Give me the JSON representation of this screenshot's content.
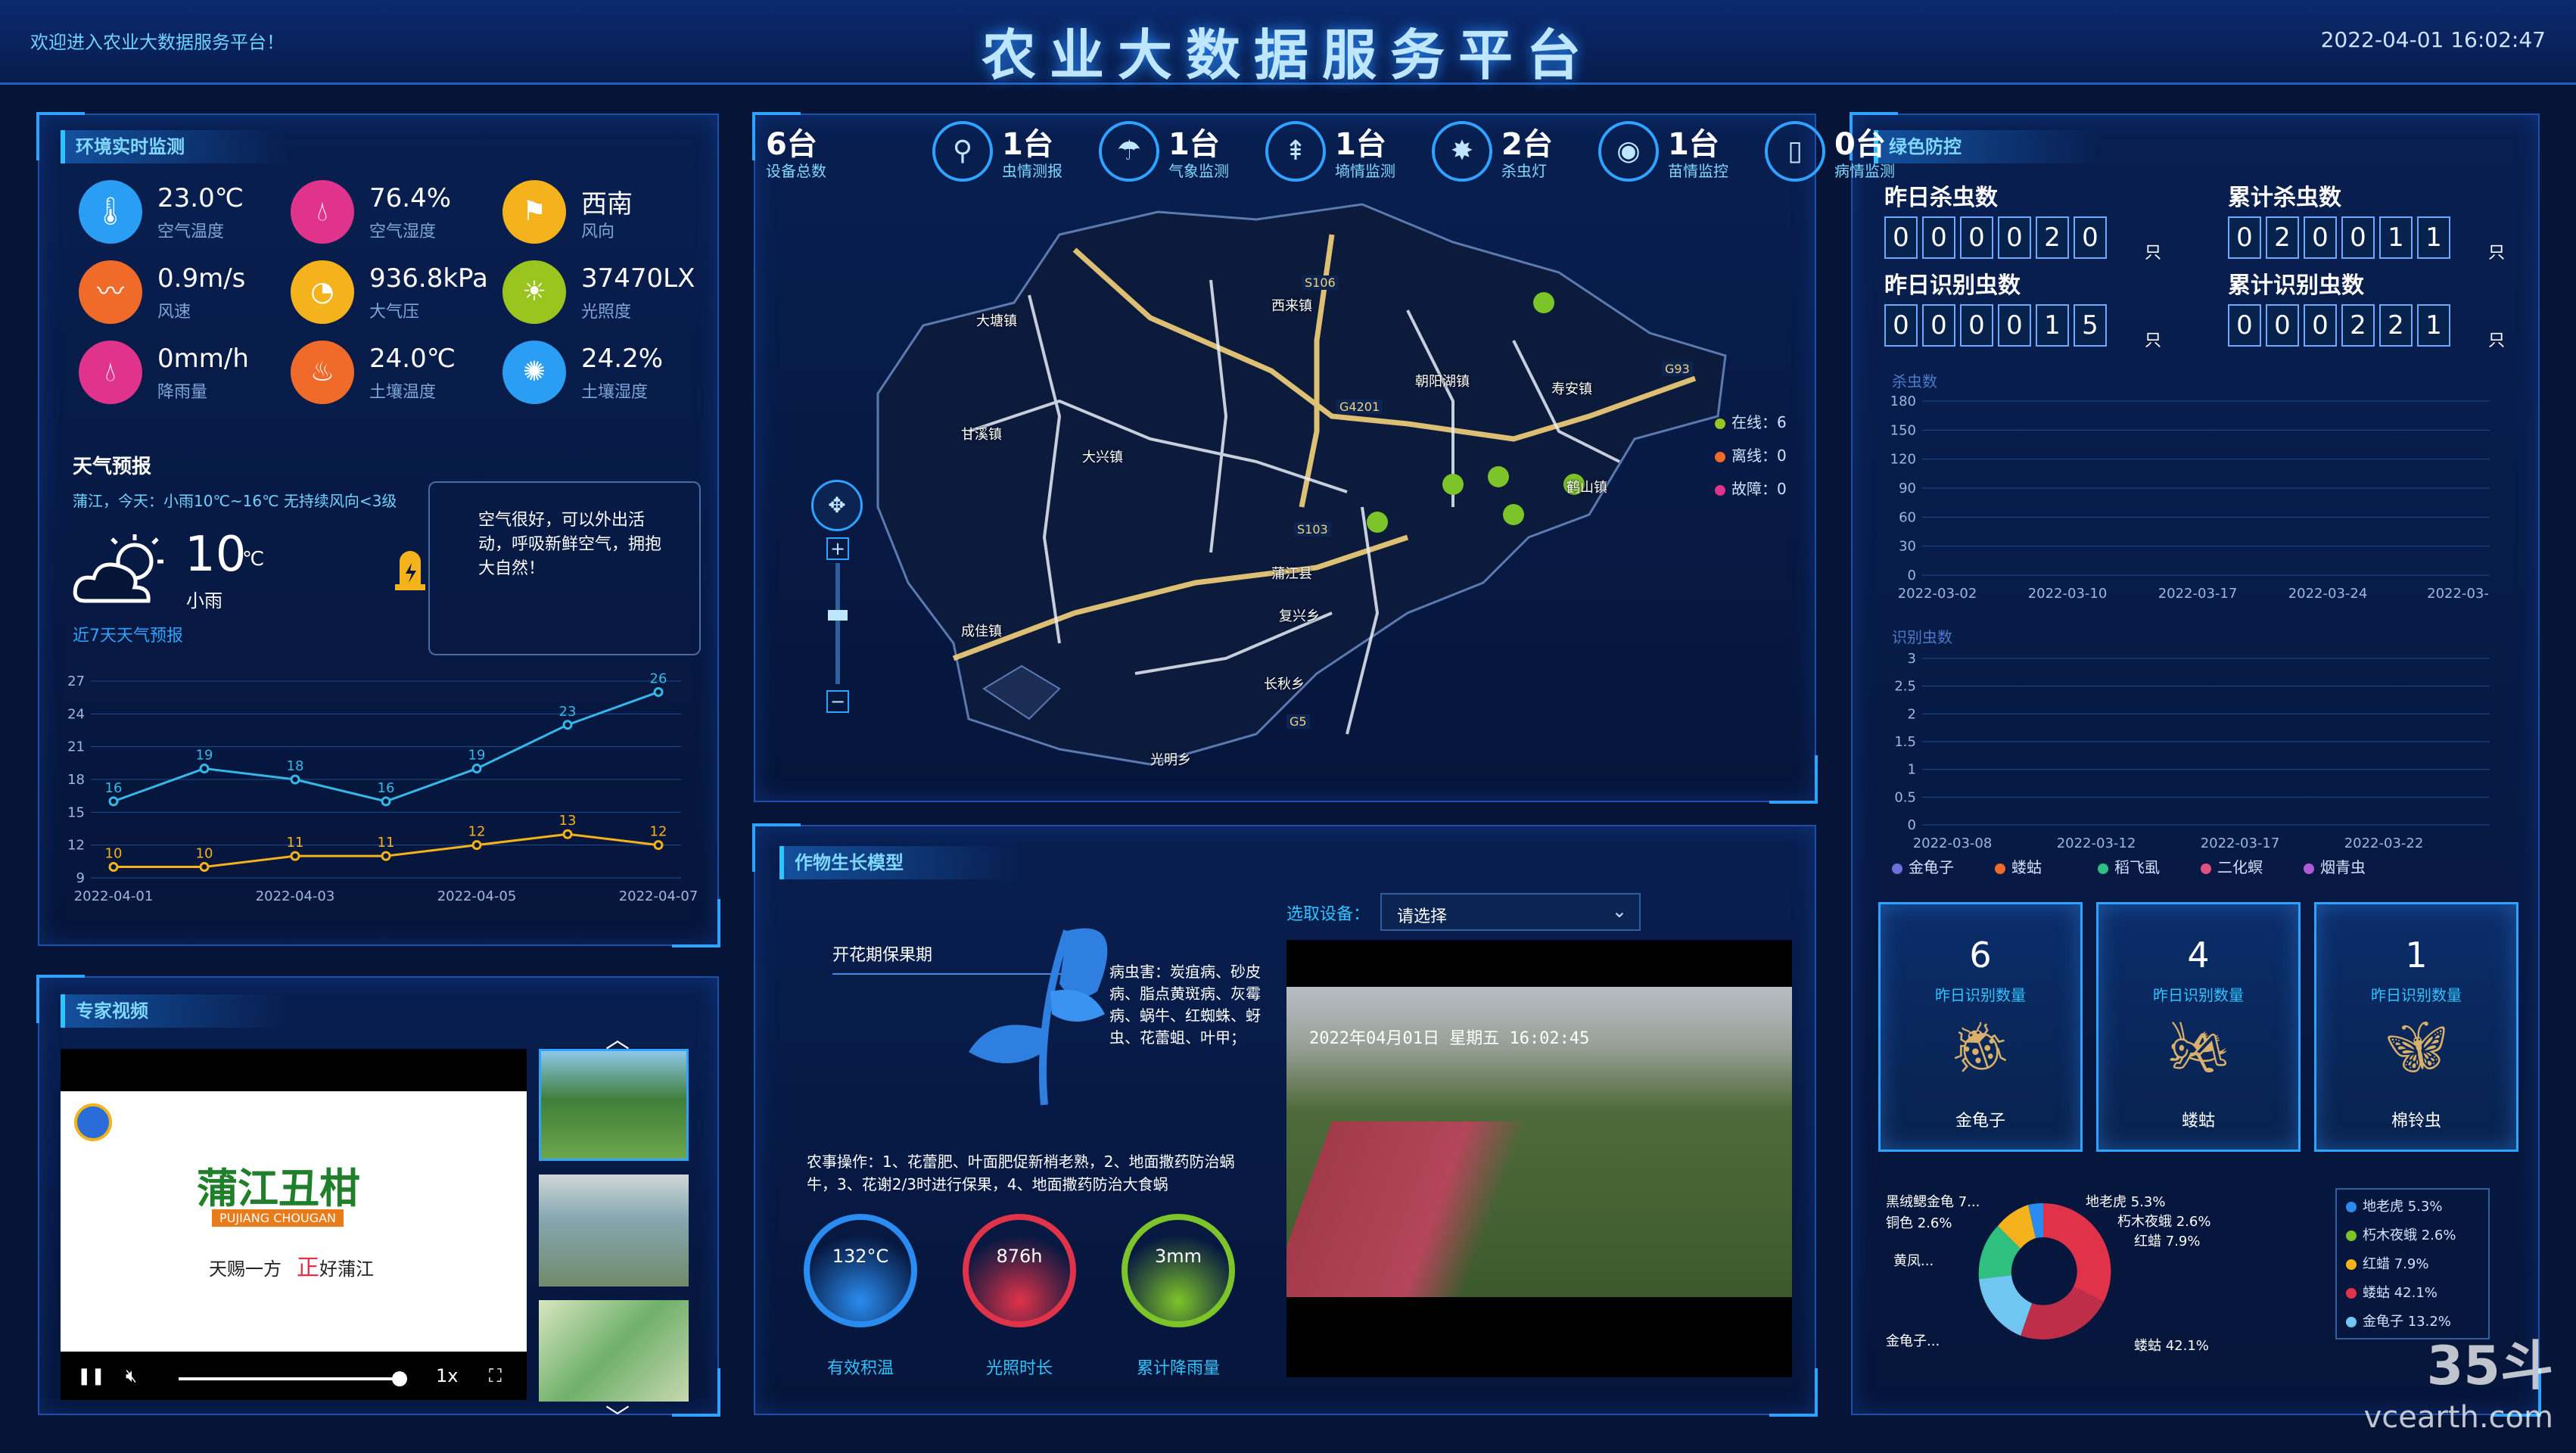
{
  "header": {
    "title": "农业大数据服务平台",
    "welcome": "欢迎进入农业大数据服务平台！",
    "datetime": "2022-04-01 16:02:47"
  },
  "env": {
    "title": "环境实时监测",
    "items": [
      {
        "value": "23.0℃",
        "label": "空气温度",
        "icon": "thermometer-icon",
        "color": "#2a9df4"
      },
      {
        "value": "76.4%",
        "label": "空气湿度",
        "icon": "humidity-icon",
        "color": "#e0338c"
      },
      {
        "value": "西南",
        "label": "风向",
        "icon": "wind-direction-icon",
        "color": "#f4b21c"
      },
      {
        "value": "0.9m/s",
        "label": "风速",
        "icon": "wind-speed-icon",
        "color": "#f06a2a"
      },
      {
        "value": "936.8kPa",
        "label": "大气压",
        "icon": "gauge-icon",
        "color": "#f4b21c"
      },
      {
        "value": "37470LX",
        "label": "光照度",
        "icon": "sun-icon",
        "color": "#9ac51f"
      },
      {
        "value": "0mm/h",
        "label": "降雨量",
        "icon": "rain-drop-icon",
        "color": "#e0338c"
      },
      {
        "value": "24.0℃",
        "label": "土壤温度",
        "icon": "soil-temp-icon",
        "color": "#f06a2a"
      },
      {
        "value": "24.2%",
        "label": "土壤湿度",
        "icon": "soil-humidity-icon",
        "color": "#2a9df4"
      }
    ]
  },
  "weather": {
    "title": "天气预报",
    "summary": "蒲江，今天：小雨10℃~16℃ 无持续风向<3级",
    "temp": "10",
    "temp_unit": "℃",
    "condition": "小雨",
    "link": "近7天天气预报",
    "alert": "空气很好，可以外出活动，呼吸新鲜空气，拥抱大自然！"
  },
  "weather_chart": {
    "type": "line",
    "x": [
      "2022-04-01",
      "2022-04-02",
      "2022-04-03",
      "2022-04-04",
      "2022-04-05",
      "2022-04-06",
      "2022-04-07"
    ],
    "x_tick_labels": [
      "2022-04-01",
      "2022-04-03",
      "2022-04-05",
      "2022-04-07"
    ],
    "y_ticks": [
      9,
      12,
      15,
      18,
      21,
      24,
      27
    ],
    "ylim": [
      9,
      27
    ],
    "series": [
      {
        "values": [
          16,
          19,
          18,
          16,
          19,
          23,
          26
        ],
        "color": "#35b8e8"
      },
      {
        "values": [
          10,
          10,
          11,
          11,
          12,
          13,
          12
        ],
        "color": "#f4b21c"
      }
    ]
  },
  "video": {
    "title": "专家视频",
    "brand_cn": "蒲江丑柑",
    "brand_en": "PUJIANG CHOUGAN",
    "slogan_a": "天赐一方",
    "slogan_b": "正",
    "slogan_c": "好蒲江",
    "speed": "1x"
  },
  "devices": [
    {
      "num": "6台",
      "label": "设备总数"
    },
    {
      "num": "1台",
      "label": "虫情测报",
      "icon": "pest-monitor-icon"
    },
    {
      "num": "1台",
      "label": "气象监测",
      "icon": "weather-station-icon"
    },
    {
      "num": "1台",
      "label": "墒情监测",
      "icon": "soil-sensor-icon"
    },
    {
      "num": "2台",
      "label": "杀虫灯",
      "icon": "insect-lamp-icon"
    },
    {
      "num": "1台",
      "label": "苗情监控",
      "icon": "camera-icon"
    },
    {
      "num": "0台",
      "label": "病情监测",
      "icon": "disease-monitor-icon"
    }
  ],
  "map": {
    "status": [
      {
        "label": "在线：6",
        "color": "#9ac51f"
      },
      {
        "label": "离线：0",
        "color": "#f06a2a"
      },
      {
        "label": "故障：0",
        "color": "#e0338c"
      }
    ],
    "towns": [
      "甘溪镇",
      "西来镇",
      "大塘镇",
      "朝阳湖镇",
      "成佳镇",
      "寿安镇",
      "鹤山镇",
      "复兴乡",
      "长秋乡",
      "大兴镇",
      "光明乡",
      "蒲江县"
    ],
    "roads": [
      "S106",
      "G4201",
      "G5",
      "S103",
      "G93"
    ]
  },
  "growth": {
    "title": "作物生长模型",
    "stage": "开花期保果期",
    "select_label": "选取设备：",
    "select_placeholder": "请选择",
    "disease": "病虫害：炭疽病、砂皮病、脂点黄斑病、灰霉病、蜗牛、红蜘蛛、蚜虫、花蕾蛆、叶甲；",
    "ops": "农事操作：1、花蕾肥、叶面肥促新梢老熟，2、地面撒药防治蜗牛，3、花谢2/3时进行保果，4、地面撒药防治大食蜗",
    "rings": [
      {
        "value": "132°C",
        "label": "有效积温",
        "color": "#2a8cf0"
      },
      {
        "value": "876h",
        "label": "光照时长",
        "color": "#e0334a"
      },
      {
        "value": "3mm",
        "label": "累计降雨量",
        "color": "#7cc42a"
      }
    ],
    "camera_overlay": "2022年04月01日 星期五 16:02:45"
  },
  "green": {
    "title": "绿色防控",
    "counters": [
      {
        "title": "昨日杀虫数",
        "digits": [
          "0",
          "0",
          "0",
          "0",
          "2",
          "0"
        ],
        "unit": "只"
      },
      {
        "title": "累计杀虫数",
        "digits": [
          "0",
          "2",
          "0",
          "0",
          "1",
          "1"
        ],
        "unit": "只"
      },
      {
        "title": "昨日识别虫数",
        "digits": [
          "0",
          "0",
          "0",
          "0",
          "1",
          "5"
        ],
        "unit": "只"
      },
      {
        "title": "累计识别虫数",
        "digits": [
          "0",
          "0",
          "0",
          "2",
          "2",
          "1"
        ],
        "unit": "只"
      }
    ],
    "kill_chart_label": "杀虫数",
    "kill_y_ticks": [
      0,
      30,
      60,
      90,
      120,
      150,
      180
    ],
    "kill_x_ticks": [
      "2022-03-02",
      "2022-03-10",
      "2022-03-17",
      "2022-03-24",
      "2022-03-"
    ],
    "ident_chart_label": "识别虫数",
    "ident_y_ticks": [
      0,
      0.5,
      1,
      1.5,
      2,
      2.5,
      3
    ],
    "ident_x_ticks": [
      "2022-03-08",
      "2022-03-12",
      "2022-03-17",
      "2022-03-22"
    ],
    "ident_legend": [
      {
        "name": "金龟子",
        "color": "#6f6fd8"
      },
      {
        "name": "蝼蛄",
        "color": "#f06a2a"
      },
      {
        "name": "稻飞虱",
        "color": "#2fbf7f"
      },
      {
        "name": "二化螟",
        "color": "#e05080"
      },
      {
        "name": "烟青虫",
        "color": "#b05ad8"
      }
    ],
    "insect_cards": [
      {
        "num": "6",
        "sub": "昨日识别数量",
        "name": "金龟子",
        "icon": "beetle-icon"
      },
      {
        "num": "4",
        "sub": "昨日识别数量",
        "name": "蝼蛄",
        "icon": "mole-cricket-icon"
      },
      {
        "num": "1",
        "sub": "昨日识别数量",
        "name": "棉铃虫",
        "icon": "moth-icon"
      }
    ],
    "pie_legend": [
      {
        "label": "地老虎 5.3%",
        "color": "#2a8cf0"
      },
      {
        "label": "朽木夜蛾 2.6%",
        "color": "#7cc42a"
      },
      {
        "label": "红蜡 7.9%",
        "color": "#f4b21c"
      },
      {
        "label": "蝼蛄 42.1%",
        "color": "#e0334a"
      },
      {
        "label": "金龟子 13.2%",
        "color": "#6fc6f0"
      }
    ],
    "pie_labels": [
      "黑绒鳃金龟 7...",
      "铜色 2.6%",
      "黄凤...",
      "金龟子...",
      "地老虎 5.3%",
      "朽木夜蛾 2.6%",
      "红蜡 7.9%",
      "蝼蛄 42.1%"
    ]
  },
  "watermark": {
    "line1": "35斗",
    "line2": "vcearth.com"
  }
}
